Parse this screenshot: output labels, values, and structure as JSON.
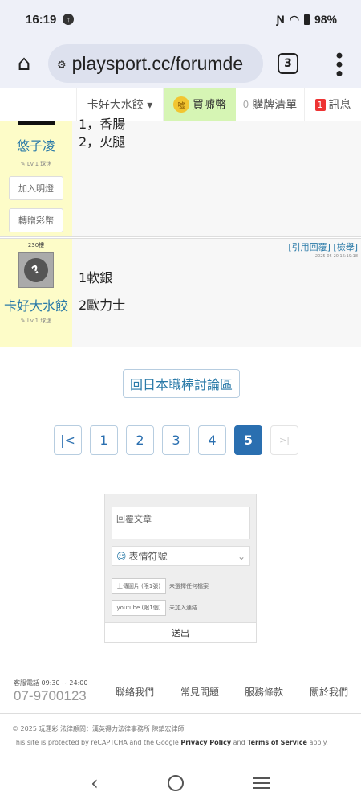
{
  "status": {
    "time": "16:19",
    "battery": "98%"
  },
  "browser": {
    "url": "playsport.cc/forumde",
    "tab_count": "3"
  },
  "nav": {
    "user": "卡好大水餃 ▾",
    "buy": "買噓幣",
    "coin_label": "噓",
    "cart_count": "0",
    "cart": "購牌清單",
    "msg_count": "1",
    "msg": "訊息"
  },
  "post1": {
    "cut_line": "1，香腸",
    "line2": "2，火腿",
    "username": "悠子凌",
    "level": "✎ Lv.1 球迷",
    "btn_light": "加入明燈",
    "btn_gift": "轉贈彩幣"
  },
  "post2": {
    "posts": "230樓",
    "avatar_glyph": "?",
    "username": "卡好大水餃",
    "level": "✎ Lv.1 球迷",
    "quote": "[引用回覆]",
    "report": "[檢舉]",
    "timestamp": "2025-05-20 16:19:18",
    "line1": "1軟銀",
    "line2": "2歐力士"
  },
  "back_button": "回日本職棒討論區",
  "pager": {
    "first": "|<",
    "pages": [
      "1",
      "2",
      "3",
      "4",
      "5"
    ],
    "last": ">|"
  },
  "reply": {
    "textarea_placeholder": "回覆文章",
    "emoji_label": "表情符號",
    "upload_btn": "上傳圖片 (限1張)",
    "upload_status": "未選擇任何檔案",
    "youtube_btn": "youtube (限1個)",
    "youtube_status": "未加入連結",
    "submit": "送出"
  },
  "footer": {
    "hotline_label": "客服電話 09:30 ~ 24:00",
    "hotline": "07-9700123",
    "links": [
      "聯絡我們",
      "常見問題",
      "服務條款",
      "關於我們"
    ],
    "copyright": "© 2025 玩運彩 法律顧問：漢英得力法律事務所 陳鎮宏律師",
    "recap_prefix": "This site is protected by reCAPTCHA and the Google ",
    "privacy": "Privacy Policy",
    "and": " and ",
    "terms": "Terms of Service",
    "apply": " apply."
  }
}
